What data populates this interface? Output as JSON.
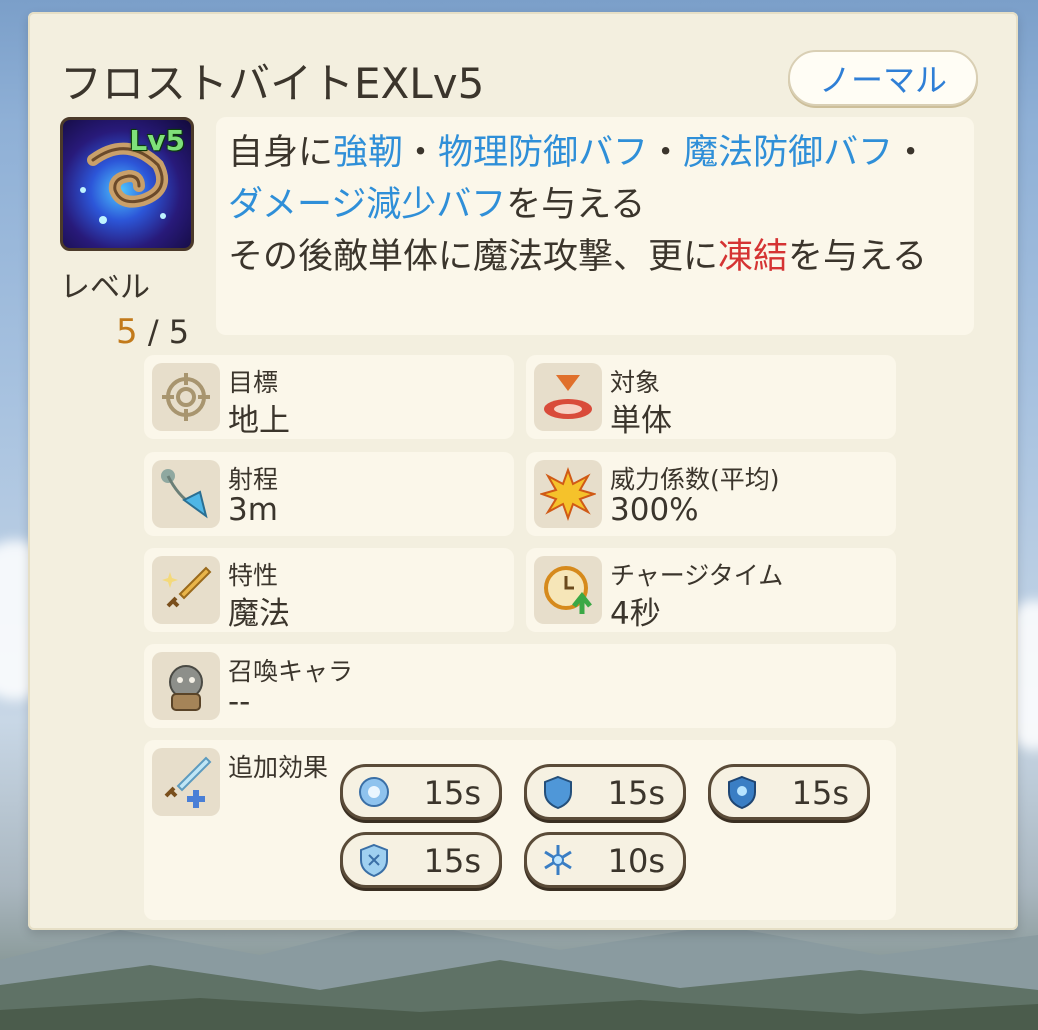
{
  "skill": {
    "title": "フロストバイトEXLv5",
    "mode_label": "ノーマル",
    "icon_badge": "Lv5",
    "level_label": "レベル",
    "level_current": "5",
    "level_sep_max": "/ 5",
    "description": {
      "p1": "自身に",
      "b1": "強靭",
      "p2": "・",
      "b2": "物理防御バフ",
      "p3": "・",
      "b3": "魔法防御バフ",
      "p4": "・",
      "b4": "ダメージ減少バフ",
      "p5": "を与える",
      "p6": "その後敵単体に魔法攻撃、更に",
      "d1": "凍結",
      "p7": "を与える"
    }
  },
  "stats": {
    "target": {
      "label": "目標",
      "value": "地上"
    },
    "scope": {
      "label": "対象",
      "value": "単体"
    },
    "range": {
      "label": "射程",
      "value": "3m"
    },
    "power": {
      "label": "威力係数(平均)",
      "value": "300%"
    },
    "attribute": {
      "label": "特性",
      "value": "魔法"
    },
    "charge": {
      "label": "チャージタイム",
      "value": "4秒"
    },
    "summon": {
      "label": "召喚キャラ",
      "value": "--"
    },
    "extra": {
      "label": "追加効果"
    }
  },
  "effects": [
    {
      "icon": "toughness-buff-icon",
      "duration": "15s"
    },
    {
      "icon": "physical-defense-buff-icon",
      "duration": "15s"
    },
    {
      "icon": "magic-defense-buff-icon",
      "duration": "15s"
    },
    {
      "icon": "damage-reduction-buff-icon",
      "duration": "15s"
    },
    {
      "icon": "freeze-icon",
      "duration": "10s"
    }
  ],
  "colors": {
    "buff_text": "#2f8fd8",
    "debuff_text": "#d53333",
    "mode_text": "#2f7fd6",
    "level_current": "#c27a1b",
    "badge_green": "#7fe07a"
  }
}
